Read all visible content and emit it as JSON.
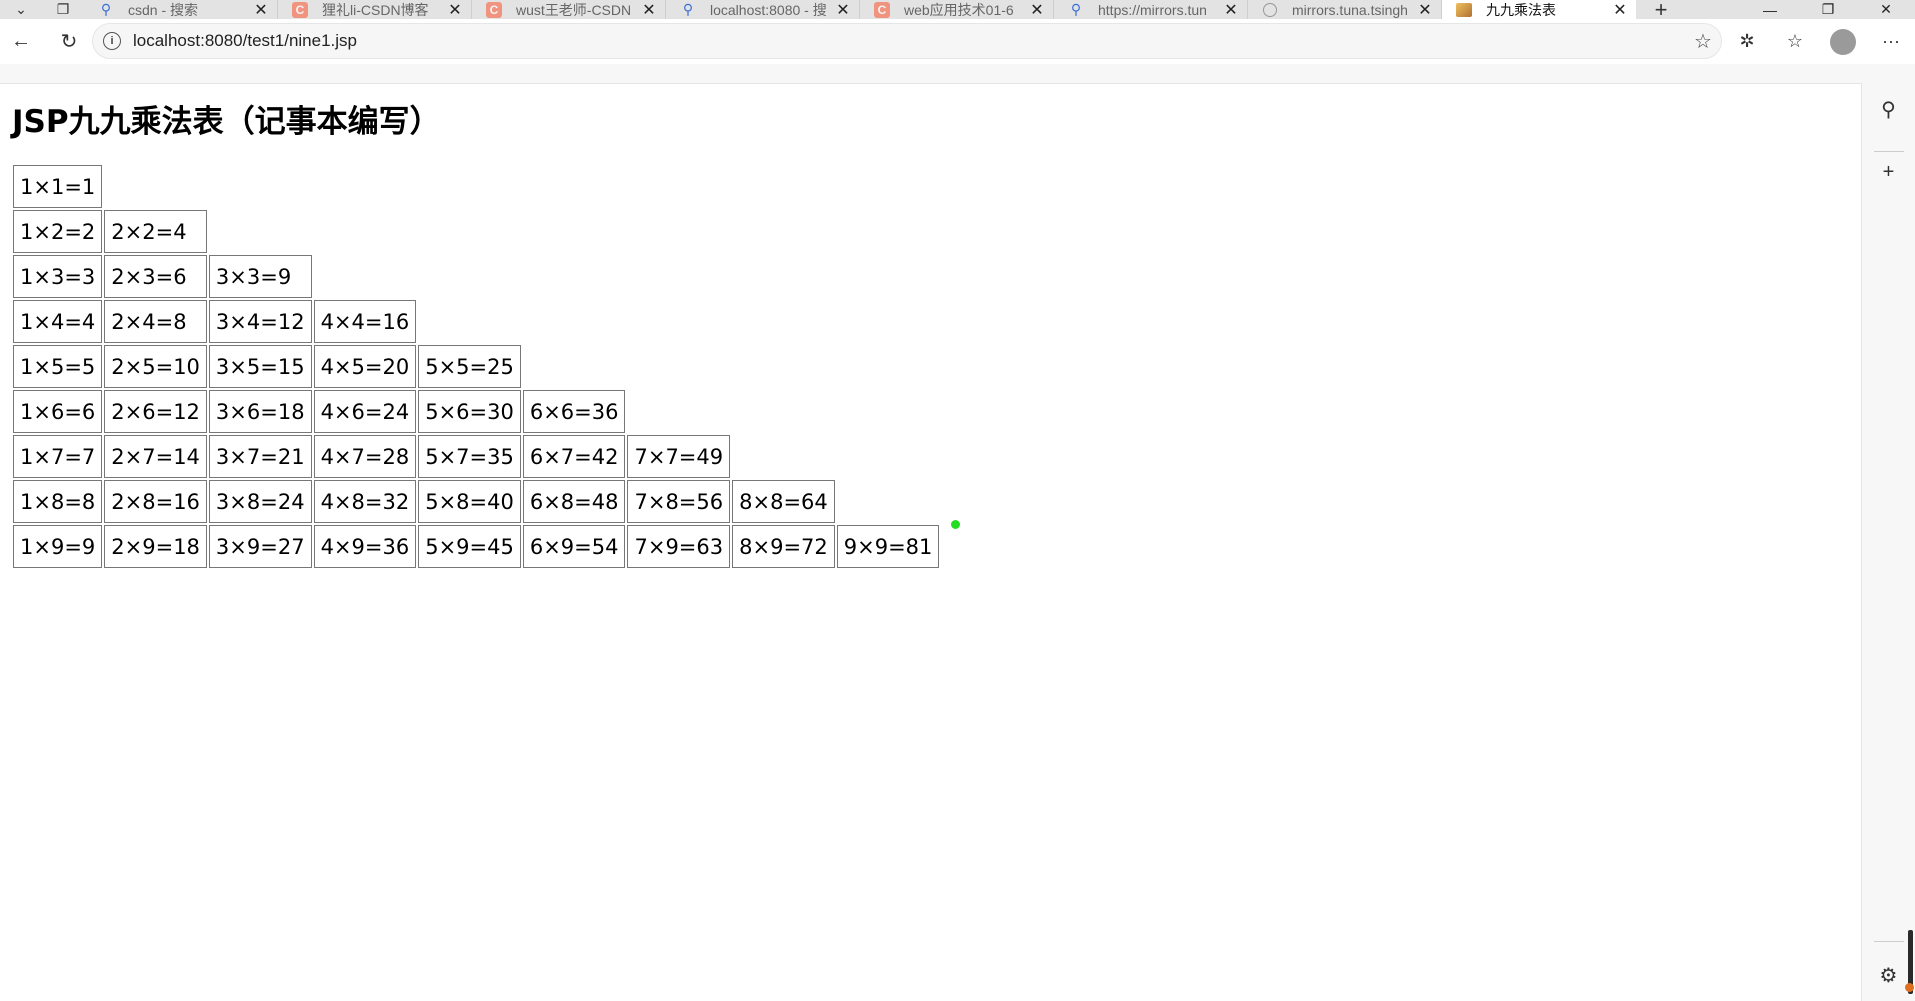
{
  "tabs": [
    {
      "title": "csdn - 搜索",
      "icon": "search-icon",
      "active": false
    },
    {
      "title": "狸礼li-CSDN博客",
      "icon": "csdn-icon",
      "active": false
    },
    {
      "title": "wust王老师-CSDN",
      "icon": "csdn-icon",
      "active": false
    },
    {
      "title": "localhost:8080 - 搜",
      "icon": "search-icon",
      "active": false
    },
    {
      "title": "web应用技术01-6",
      "icon": "csdn-icon",
      "active": false
    },
    {
      "title": "https://mirrors.tun",
      "icon": "search-icon",
      "active": false
    },
    {
      "title": "mirrors.tuna.tsingh",
      "icon": "globe-icon",
      "active": false
    },
    {
      "title": "九九乘法表",
      "icon": "image-icon",
      "active": true
    }
  ],
  "address": {
    "url": "localhost:8080/test1/nine1.jsp"
  },
  "page": {
    "title": "JSP九九乘法表（记事本编写）",
    "rows": [
      [
        "1×1=1"
      ],
      [
        "1×2=2",
        "2×2=4"
      ],
      [
        "1×3=3",
        "2×3=6",
        "3×3=9"
      ],
      [
        "1×4=4",
        "2×4=8",
        "3×4=12",
        "4×4=16"
      ],
      [
        "1×5=5",
        "2×5=10",
        "3×5=15",
        "4×5=20",
        "5×5=25"
      ],
      [
        "1×6=6",
        "2×6=12",
        "3×6=18",
        "4×6=24",
        "5×6=30",
        "6×6=36"
      ],
      [
        "1×7=7",
        "2×7=14",
        "3×7=21",
        "4×7=28",
        "5×7=35",
        "6×7=42",
        "7×7=49"
      ],
      [
        "1×8=8",
        "2×8=16",
        "3×8=24",
        "4×8=32",
        "5×8=40",
        "6×8=48",
        "7×8=56",
        "8×8=64"
      ],
      [
        "1×9=9",
        "2×9=18",
        "3×9=27",
        "4×9=36",
        "5×9=45",
        "6×9=54",
        "7×9=63",
        "8×9=72",
        "9×9=81"
      ]
    ]
  },
  "colors": {
    "accent_dot": "#22dd22",
    "csdn": "#fc5531"
  }
}
